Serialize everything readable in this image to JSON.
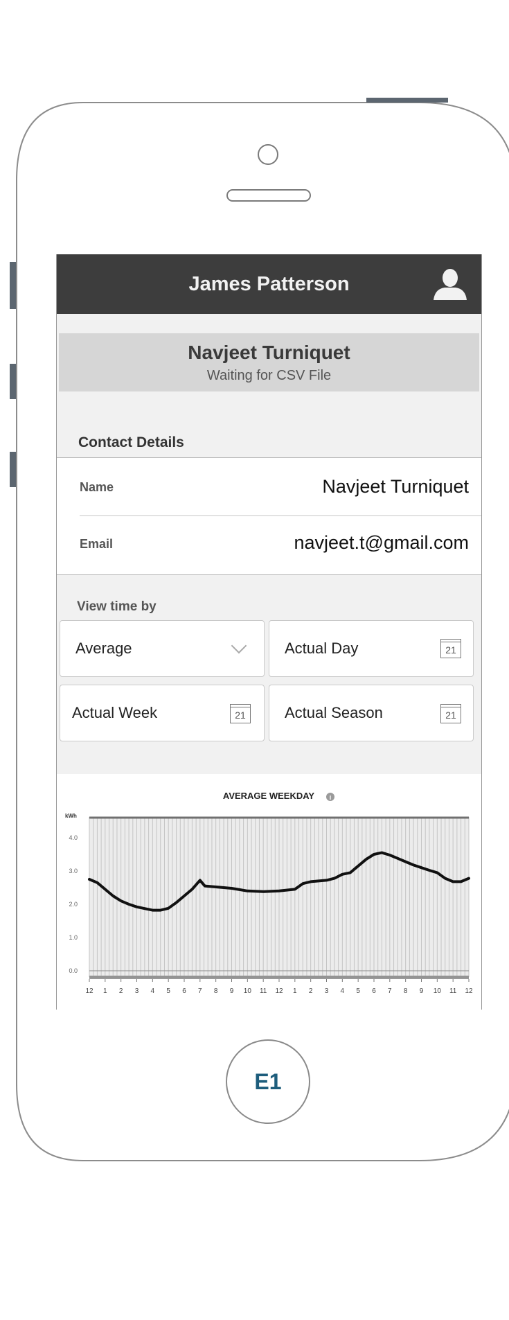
{
  "header": {
    "title": "James Patterson",
    "user_icon": "user-icon"
  },
  "banner": {
    "name": "Navjeet Turniquet",
    "status": "Waiting for CSV File"
  },
  "contact": {
    "section_title": "Contact Details",
    "rows": [
      {
        "label": "Name",
        "value": "Navjeet Turniquet"
      },
      {
        "label": "Email",
        "value": "navjeet.t@gmail.com"
      }
    ]
  },
  "view_time": {
    "label": "View time by",
    "options": [
      {
        "label": "Average",
        "icon": "chevron-down-icon"
      },
      {
        "label": "Actual Day",
        "icon": "calendar-icon",
        "icon_text": "21"
      },
      {
        "label": "Actual Week",
        "icon": "calendar-icon",
        "icon_text": "21"
      },
      {
        "label": "Actual Season",
        "icon": "calendar-icon",
        "icon_text": "21"
      }
    ]
  },
  "home_button": {
    "label": "E1"
  },
  "chart_data": {
    "type": "line",
    "title": "AVERAGE WEEKDAY",
    "ylabel": "kWh",
    "xlabel": "",
    "x_ticks": [
      "12",
      "1",
      "2",
      "3",
      "4",
      "5",
      "6",
      "7",
      "8",
      "9",
      "10",
      "11",
      "12",
      "1",
      "2",
      "3",
      "4",
      "5",
      "6",
      "7",
      "8",
      "9",
      "10",
      "11",
      "12"
    ],
    "y_ticks": [
      "0.0",
      "1.0",
      "2.0",
      "3.0",
      "4.0"
    ],
    "ylim": [
      0,
      4.5
    ],
    "xlim": [
      0,
      24
    ],
    "grid": true,
    "series": [
      {
        "values": [
          [
            0,
            2.75
          ],
          [
            0.5,
            2.65
          ],
          [
            1,
            2.45
          ],
          [
            1.5,
            2.25
          ],
          [
            2,
            2.1
          ],
          [
            2.5,
            2.0
          ],
          [
            3,
            1.92
          ],
          [
            3.5,
            1.87
          ],
          [
            4,
            1.82
          ],
          [
            4.5,
            1.82
          ],
          [
            5,
            1.88
          ],
          [
            5.5,
            2.05
          ],
          [
            6,
            2.25
          ],
          [
            6.5,
            2.45
          ],
          [
            7,
            2.72
          ],
          [
            7.3,
            2.55
          ],
          [
            8,
            2.52
          ],
          [
            9,
            2.48
          ],
          [
            10,
            2.4
          ],
          [
            11,
            2.38
          ],
          [
            12,
            2.4
          ],
          [
            13,
            2.45
          ],
          [
            13.5,
            2.62
          ],
          [
            14,
            2.68
          ],
          [
            15,
            2.72
          ],
          [
            15.5,
            2.78
          ],
          [
            16,
            2.9
          ],
          [
            16.5,
            2.95
          ],
          [
            17,
            3.15
          ],
          [
            17.5,
            3.35
          ],
          [
            18,
            3.5
          ],
          [
            18.5,
            3.55
          ],
          [
            19,
            3.48
          ],
          [
            19.5,
            3.38
          ],
          [
            20,
            3.28
          ],
          [
            20.5,
            3.18
          ],
          [
            21,
            3.1
          ],
          [
            21.5,
            3.02
          ],
          [
            22,
            2.95
          ],
          [
            22.5,
            2.78
          ],
          [
            23,
            2.68
          ],
          [
            23.5,
            2.68
          ],
          [
            24,
            2.78
          ]
        ]
      }
    ]
  }
}
